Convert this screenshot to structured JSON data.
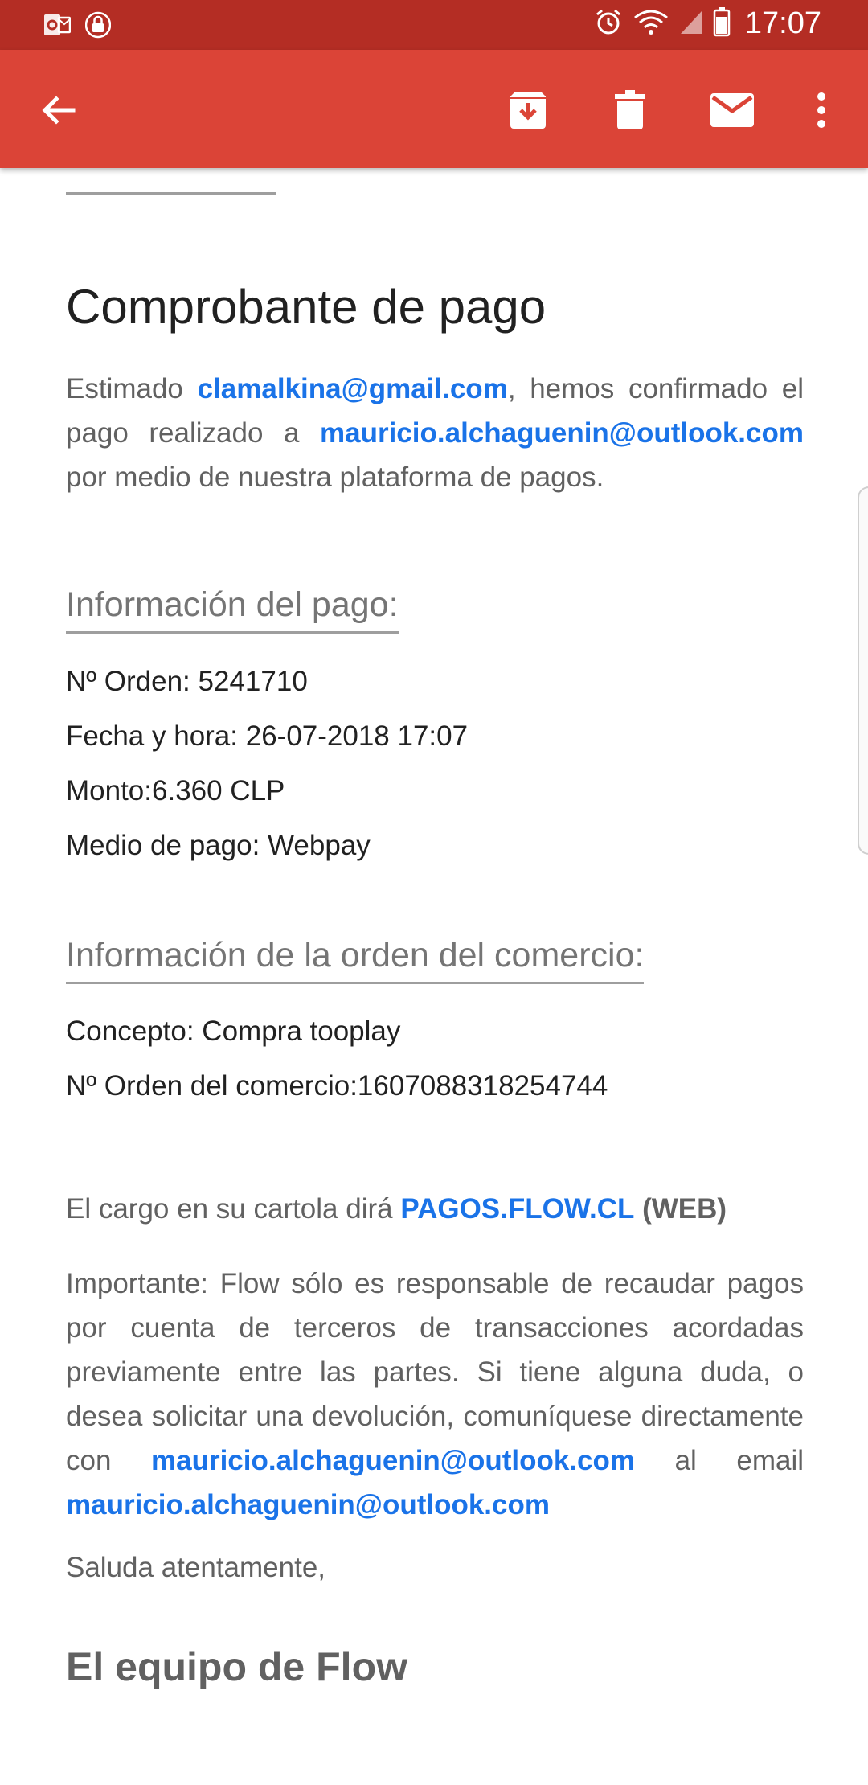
{
  "status_bar": {
    "time": "17:07",
    "left_icons": [
      "outlook-notification-icon",
      "lock-notification-icon"
    ],
    "right_icons": [
      "alarm-icon",
      "wifi-icon",
      "signal-icon",
      "battery-icon"
    ]
  },
  "app_bar": {
    "icons": [
      "back-arrow-icon",
      "archive-icon",
      "delete-icon",
      "mark-unread-icon",
      "more-vert-icon"
    ],
    "accent_color": "#db4437",
    "status_color": "#b42d24"
  },
  "email": {
    "title": "Comprobante de pago",
    "greeting": {
      "prefix": "Estimado ",
      "payer_email": "clamalkina@gmail.com",
      "middle": ", hemos confirmado el pago realizado a ",
      "merchant_email": "mauricio.alchaguenin@outlook.com",
      "suffix": " por medio de nuestra plataforma de pagos."
    },
    "payment_info": {
      "heading": "Información del pago:",
      "order_label": "Nº Orden:",
      "order_value": "5241710",
      "date_label": "Fecha y hora:",
      "date_value": "26-07-2018 17:07",
      "amount_label": "Monto:",
      "amount_value": "6.360 CLP",
      "method_label": "Medio de pago:",
      "method_value": "Webpay"
    },
    "merchant_info": {
      "heading": "Información de la orden del comercio:",
      "concept_label": "Concepto:",
      "concept_value": "Compra tooplay",
      "merchant_order_label": "Nº Orden del comercio:",
      "merchant_order_value": "1607088318254744"
    },
    "statement": {
      "prefix": "El cargo en su cartola dirá ",
      "link": "PAGOS.FLOW.CL",
      "suffix": "(WEB)"
    },
    "notice": {
      "text": "Importante: Flow sólo es responsable de recaudar pagos por cuenta de terceros de transacciones acordadas previamente entre las partes. Si tiene alguna duda, o desea solicitar una devolución, comuníquese directamente con ",
      "link1": "mauricio.alchaguenin@outlook.com",
      "middle": " al email ",
      "link2": "mauricio.alchaguenin@outlook.com"
    },
    "closing": "Saluda atentamente,",
    "signature": "El equipo de Flow",
    "link_color": "#1a73e8"
  }
}
